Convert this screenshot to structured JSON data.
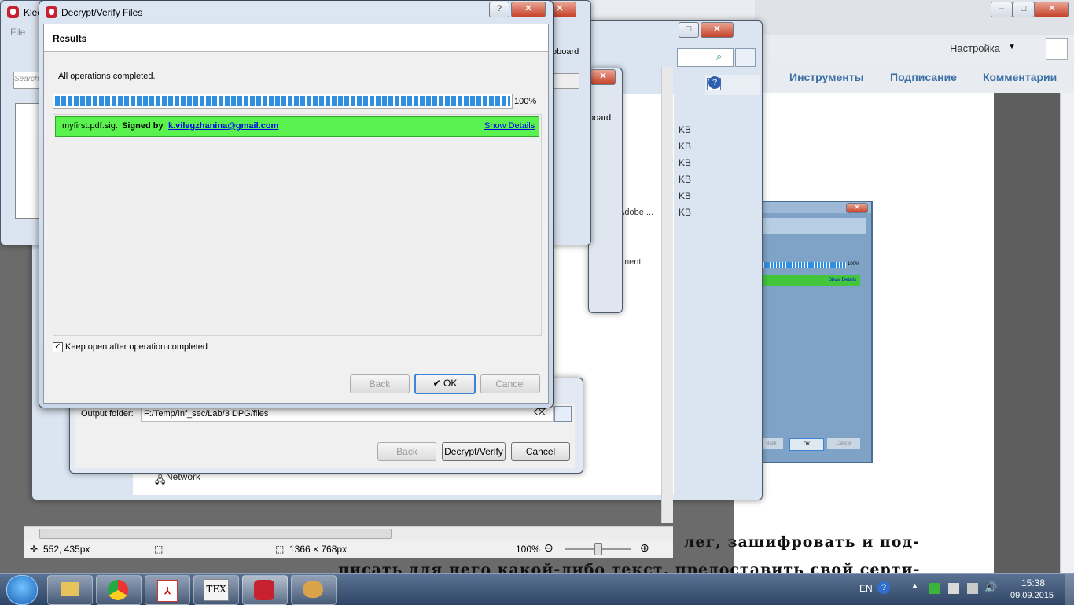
{
  "background": {
    "acrobat": {
      "menu_label": "Настройка",
      "panel_links": [
        "Инструменты",
        "Подписание",
        "Комментарии"
      ],
      "doc_line1": "лег, зашифровать и под-",
      "doc_line2": "писать для него какой-либо текст, предоставить свой серти-"
    },
    "kleo_title": "Kleo",
    "kleo_menu_file": "File",
    "kleo_search_placeholder": "Search",
    "clipboard_label": "oboard",
    "clipboard_label2": "board",
    "explorer_sizes": [
      "KB",
      "KB",
      "KB",
      "KB",
      "KB",
      "KB"
    ],
    "explorer_item_adobe": "Adobe ...",
    "explorer_item_ment": "ment",
    "explorer_network": "Network",
    "thumb_percent": "100%",
    "thumb_show_details": "Show Details",
    "thumb_ok": "OK",
    "thumb_cancel": "Cancel",
    "thumb_back": "Back"
  },
  "viewer_status": {
    "cursor": "552, 435px",
    "size": "1366 × 768px",
    "zoom": "100%"
  },
  "decrypt_window": {
    "output_label": "Output folder:",
    "output_path": "F:/Temp/Inf_sec/Lab/3 DPG/files",
    "back": "Back",
    "decrypt_verify": "Decrypt/Verify",
    "cancel": "Cancel"
  },
  "dialog": {
    "title": "Decrypt/Verify Files",
    "header": "Results",
    "status": "All operations completed.",
    "progress_percent": "100%",
    "progress_value": 1.0,
    "result": {
      "file": "myfirst.pdf.sig:",
      "signed_by": "Signed by",
      "email": "k.vilegzhanina@gmail.com",
      "details_link": "Show Details",
      "color": "#5af24f"
    },
    "keep_open_label": "Keep open after operation completed",
    "keep_open_checked": true,
    "buttons": {
      "back": "Back",
      "ok": "OK",
      "cancel": "Cancel"
    }
  },
  "taskbar": {
    "lang": "EN",
    "time": "15:38",
    "date": "09.09.2015",
    "tex_label": "TEX"
  }
}
